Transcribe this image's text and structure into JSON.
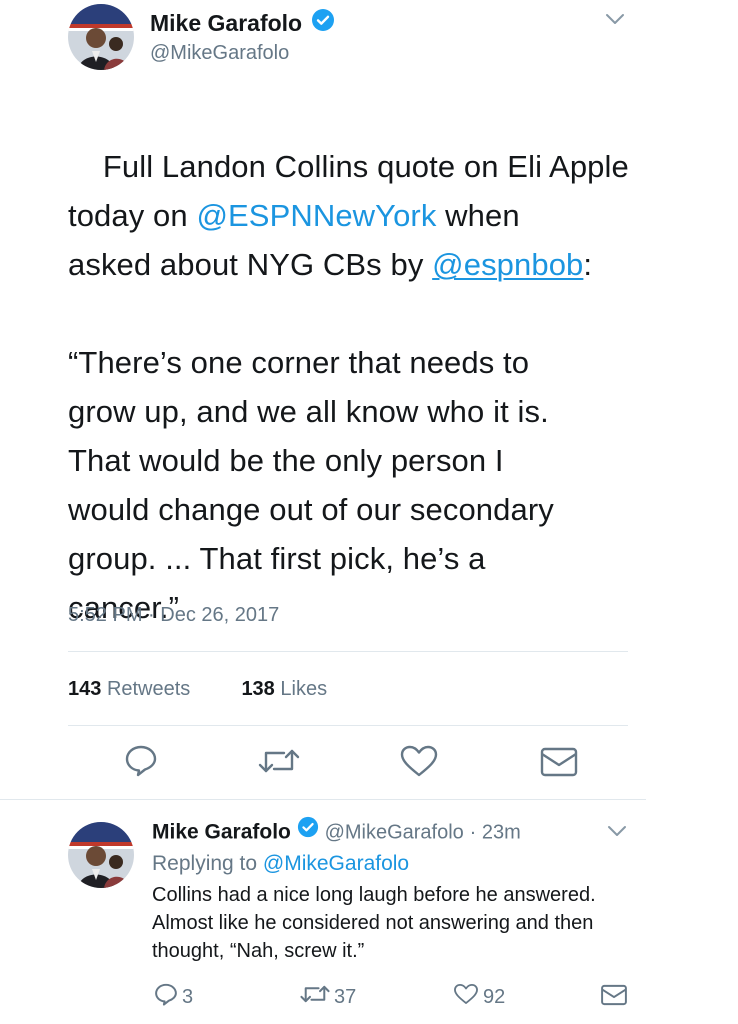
{
  "main_tweet": {
    "author_name": "Mike Garafolo",
    "author_handle": "@MikeGarafolo",
    "text_part1": "Full Landon Collins quote on Eli Apple\ntoday on ",
    "mention1": "@ESPNNewYork",
    "text_part2": " when\nasked about NYG CBs by ",
    "mention2": "@espnbob",
    "text_part3": ":\n\n“There’s one corner that needs to\ngrow up, and we all know who it is.\nThat would be the only person I\nwould change out of our secondary\ngroup. ... That first pick, he’s a\ncancer.”",
    "timestamp": "5:52 PM · Dec 26, 2017",
    "retweets_count": "143",
    "retweets_label": "Retweets",
    "likes_count": "138",
    "likes_label": "Likes"
  },
  "reply_tweet": {
    "author_name": "Mike Garafolo",
    "author_handle": "@MikeGarafolo",
    "time_ago": "· 23m",
    "replying_label": "Replying to",
    "replying_to": "@MikeGarafolo",
    "text": "Collins had a nice long laugh before he answered. Almost like he considered not answering and then thought, “Nah, screw it.”",
    "reply_count": "3",
    "retweet_count": "37",
    "like_count": "92"
  },
  "icons": {
    "verified": "verified-badge-icon",
    "menu": "chevron-down-icon",
    "reply": "reply-icon",
    "retweet": "retweet-icon",
    "like": "heart-icon",
    "dm": "envelope-icon"
  },
  "colors": {
    "link": "#1b95e0",
    "secondary_text": "#657786",
    "divider": "#e1e8ed",
    "icon": "#657786"
  }
}
